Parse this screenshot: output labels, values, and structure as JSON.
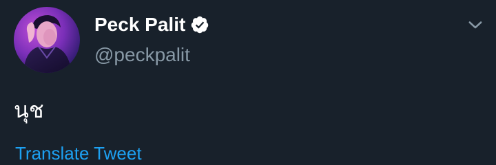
{
  "tweet": {
    "display_name": "Peck Palit",
    "verified": true,
    "handle": "@peckpalit",
    "text": "นุช",
    "translate_label": "Translate Tweet"
  },
  "icons": {
    "verified": "verified-badge-icon",
    "menu": "chevron-down-icon",
    "avatar": "profile-photo"
  },
  "colors": {
    "background": "#18212b",
    "name": "#ffffff",
    "handle": "#8899a6",
    "link": "#1da1f2",
    "caret": "#8899a6"
  }
}
